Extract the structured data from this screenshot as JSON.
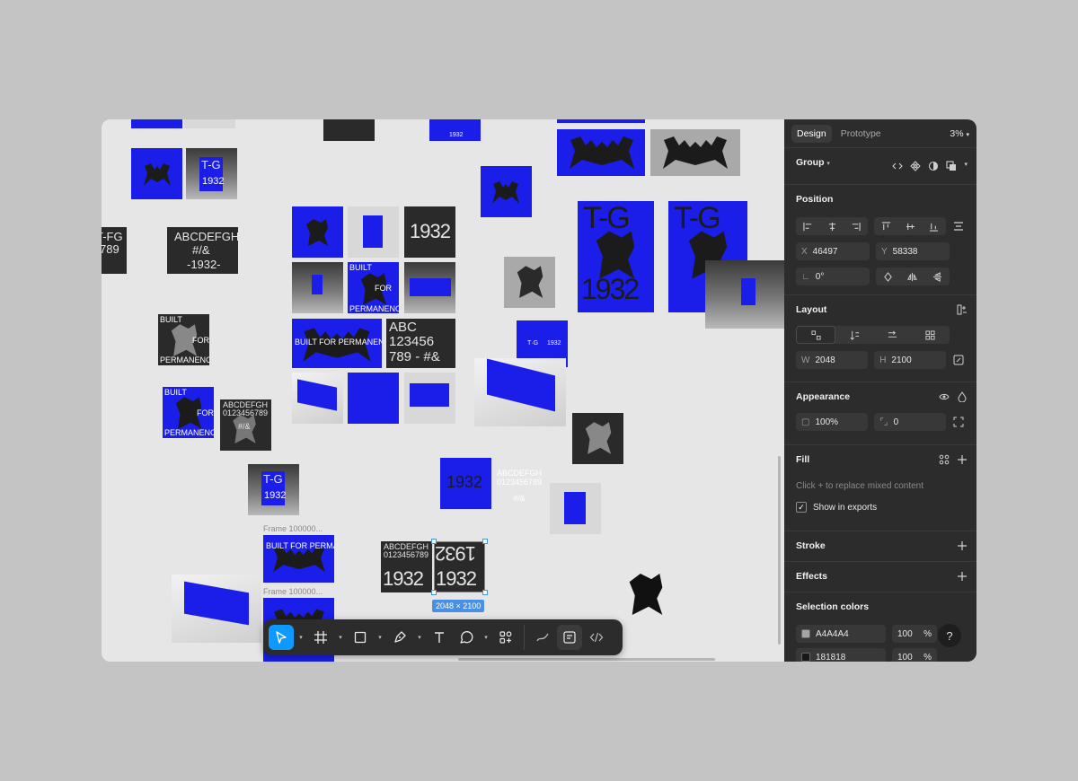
{
  "panel": {
    "tabs": [
      {
        "label": "Design"
      },
      {
        "label": "Prototype"
      }
    ],
    "zoom": "3%",
    "selection_type": "Group",
    "position": {
      "title": "Position",
      "x_label": "X",
      "x": "46497",
      "y_label": "Y",
      "y": "58338",
      "rotation": "0°"
    },
    "layout": {
      "title": "Layout",
      "w_label": "W",
      "w": "2048",
      "h_label": "H",
      "h": "2100"
    },
    "appearance": {
      "title": "Appearance",
      "opacity": "100%",
      "radius": "0"
    },
    "fill": {
      "title": "Fill",
      "hint": "Click + to replace mixed content",
      "show_exports": "Show in exports"
    },
    "stroke": {
      "title": "Stroke"
    },
    "effects": {
      "title": "Effects"
    },
    "selection_colors": {
      "title": "Selection colors",
      "items": [
        {
          "hex": "A4A4A4",
          "opacity": "100",
          "pct": "%",
          "color": "#a4a4a4"
        },
        {
          "hex": "181818",
          "opacity": "100",
          "pct": "%",
          "color": "#181818"
        }
      ]
    },
    "help": "?"
  },
  "canvas": {
    "frame_labels": [
      "Frame 100000...",
      "Frame 100000..."
    ],
    "selection_size": "2048 × 2100",
    "texts": {
      "tg": "T-G",
      "year": "1932",
      "alpha": "ABCDEFGH",
      "hash": "#/&",
      "year_dash": "-1932-",
      "built": "BUILT",
      "for": "FOR",
      "permanence": "PERMANENCE",
      "built_full": "BUILT FOR PERMANENCE",
      "abc": "ABC",
      "n123456": "123456",
      "n789": "789 - #&",
      "digits": "0123456789",
      "tfg": "T-FG",
      "n789s": "789",
      "small_tg": "T·G",
      "small_year": "1932"
    }
  },
  "colors": {
    "accent": "#0d99ff",
    "brand_blue": "#1a1ee8",
    "selection": "#4a90e2"
  }
}
